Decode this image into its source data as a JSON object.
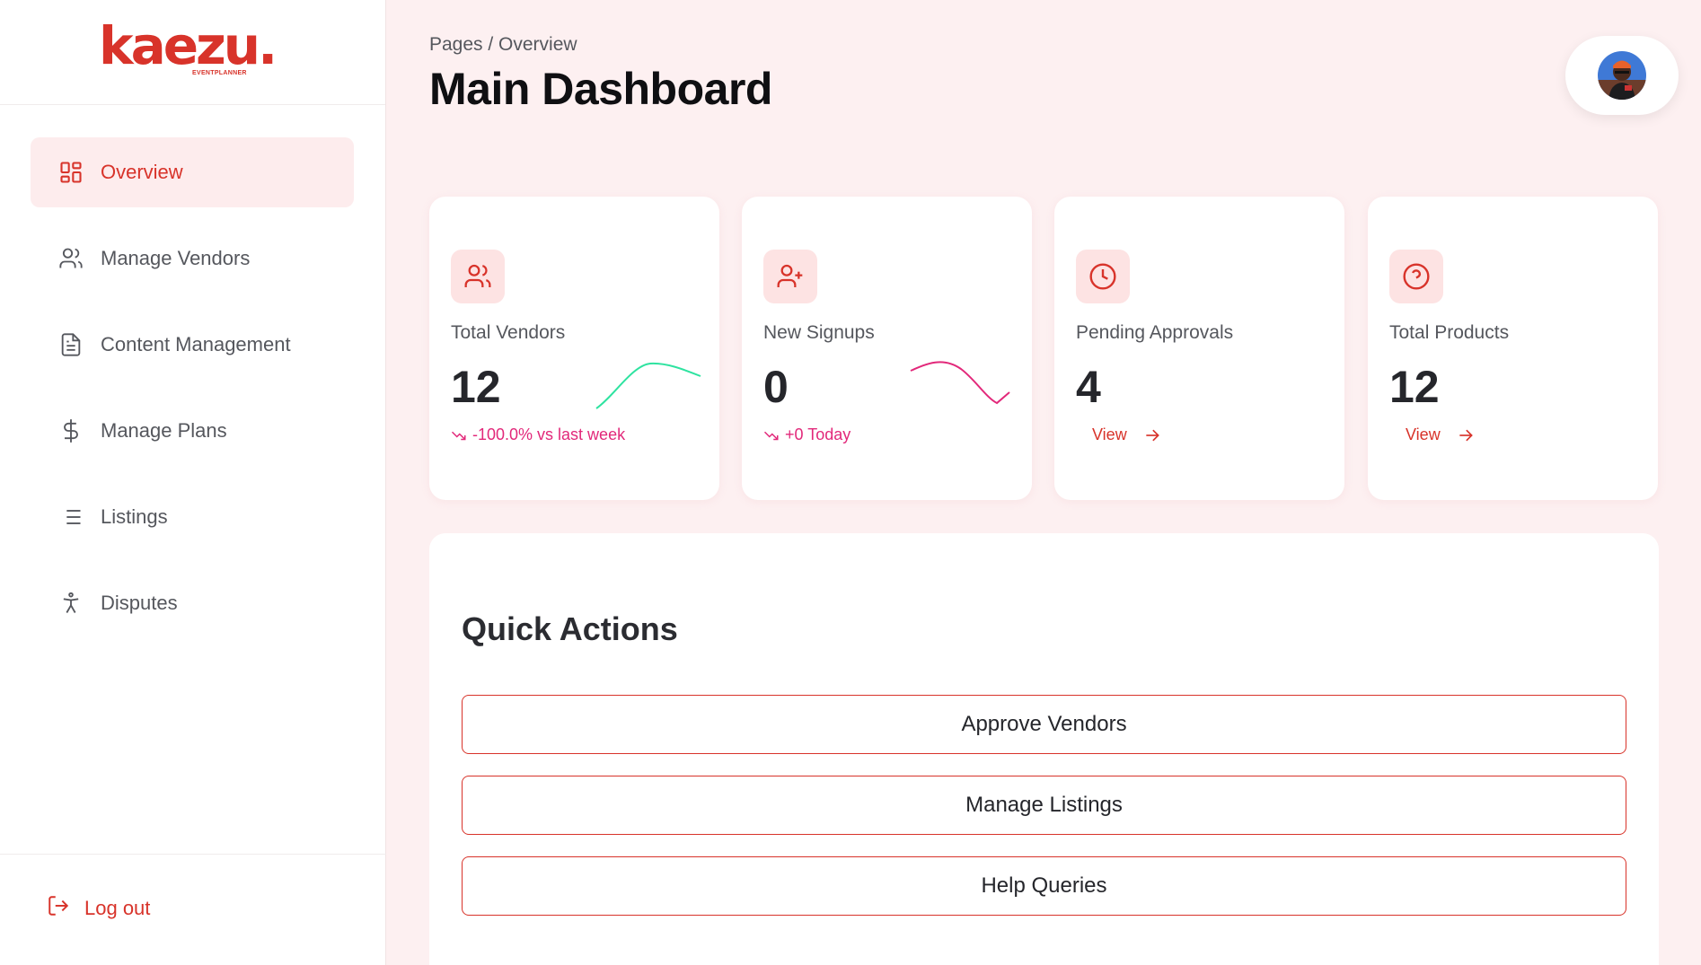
{
  "brand": {
    "name": "kaezu.",
    "tagline": "EVENTPLANNER",
    "color": "#d8332a"
  },
  "sidebar": {
    "items": [
      {
        "label": "Overview",
        "icon": "grid-icon",
        "active": true
      },
      {
        "label": "Manage Vendors",
        "icon": "users-icon"
      },
      {
        "label": "Content Management",
        "icon": "document-icon"
      },
      {
        "label": "Manage Plans",
        "icon": "dollar-icon"
      },
      {
        "label": "Listings",
        "icon": "list-icon"
      },
      {
        "label": "Disputes",
        "icon": "accessibility-icon"
      }
    ],
    "logout_label": "Log out"
  },
  "header": {
    "breadcrumb": "Pages / Overview",
    "title": "Main Dashboard"
  },
  "cards": [
    {
      "label": "Total Vendors",
      "value": "12",
      "trend": "-100.0% vs last week",
      "icon": "users-icon",
      "sparkline": "rising",
      "sparkline_color": "#2ee3a0"
    },
    {
      "label": "New Signups",
      "value": "0",
      "trend": "+0 Today",
      "icon": "user-plus-icon",
      "sparkline": "peak-then-fall",
      "sparkline_color": "#e2287a"
    },
    {
      "label": "Pending Approvals",
      "value": "4",
      "link": "View",
      "icon": "clock-icon"
    },
    {
      "label": "Total Products",
      "value": "12",
      "link": "View",
      "icon": "help-circle-icon"
    }
  ],
  "quick_actions": {
    "title": "Quick Actions",
    "buttons": [
      "Approve Vendors",
      "Manage Listings",
      "Help Queries"
    ]
  },
  "colors": {
    "accent": "#d8332a",
    "trend": "#e2287a",
    "background": "#fdf0f1"
  }
}
